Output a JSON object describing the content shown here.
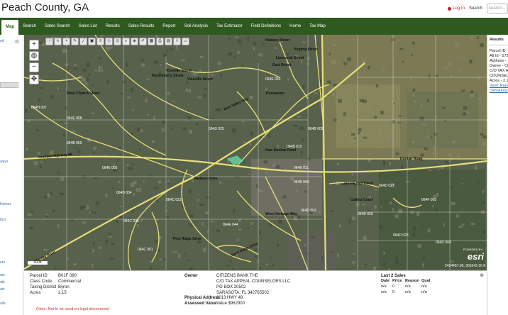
{
  "header": {
    "title": "Peach County, GA",
    "login_label": "Log In",
    "search_label": "Search",
    "search_placeholder": "search..."
  },
  "nav": {
    "items": [
      {
        "label": "Map",
        "active": true
      },
      {
        "label": "Search"
      },
      {
        "label": "Sales Search"
      },
      {
        "label": "Sales List"
      },
      {
        "label": "Results"
      },
      {
        "label": "Sales Results"
      },
      {
        "label": "Report"
      },
      {
        "label": "Soil Analysis"
      },
      {
        "label": "Tax Estimator"
      },
      {
        "label": "Field Definitions"
      },
      {
        "label": "Home"
      },
      {
        "label": "Tax Map"
      }
    ]
  },
  "left_panel": {
    "fragments": [
      "ed",
      "ways",
      "Homes",
      "trict",
      "ers",
      "ats",
      "ats",
      "ats",
      "ults"
    ]
  },
  "right_panel": {
    "title": "Results",
    "lines": [
      "Parcel ID -",
      "Alt Id - 573",
      "Address - 1",
      "Owner - Ci",
      "C/O TAX A",
      "COUNSELI",
      "Acres - 2.1",
      "View: Repo",
      "Definitions"
    ]
  },
  "map": {
    "coords": "2434457.96, 956342.16 ft",
    "esri_text": "esri",
    "powered_by": "POWERED BY",
    "scale_label": "600ft",
    "labels": [
      {
        "text": "Hudson Street"
      },
      {
        "text": "Virginia Street"
      },
      {
        "text": "Lipscomb Street"
      },
      {
        "text": "East Street"
      },
      {
        "text": "Vineville Street"
      },
      {
        "text": "Huckleberry Street"
      },
      {
        "text": "Vineville Street"
      },
      {
        "text": "West Church Street"
      },
      {
        "text": "Rich Valley Way"
      },
      {
        "text": "Thomaston"
      },
      {
        "text": "Georgia Highway 96"
      },
      {
        "text": "New Dunbar Road"
      },
      {
        "text": "Dunbar Road"
      },
      {
        "text": "Jessee Hall Court"
      },
      {
        "text": "Collins Court"
      },
      {
        "text": "Redbud Drive"
      },
      {
        "text": "Pine Ridge Drive"
      },
      {
        "text": "Sand Ridge Drive"
      },
      {
        "text": "West Heritage Way"
      },
      {
        "text": "Conley Road"
      }
    ],
    "parcels": [
      "064H 007",
      "064E 008",
      "064E 059",
      "064E 005",
      "064D 034",
      "064C 033",
      "064C 023",
      "064B 010",
      "064D 003",
      "064B 011",
      "064C 001",
      "064F 003",
      "064B 005",
      "064B 009",
      "064D 027",
      "064B 026",
      "064D 023",
      "064D 004",
      "064E 063",
      "064E 044",
      "064D 025"
    ]
  },
  "info": {
    "fields": [
      {
        "label": "Parcel ID",
        "value": "B01F 080"
      },
      {
        "label": "Class Code",
        "value": "Commercial"
      },
      {
        "label": "Taxing District",
        "value": "Byron"
      },
      {
        "label": "Acres",
        "value": "2.15"
      }
    ],
    "owner_label": "Owner",
    "owner_lines": [
      "CITIZENS BANK THE",
      "C/O TAX APPEAL COUNSELORS LLC",
      "PO BOX 20502",
      "SARASOTA, FL 342765502"
    ],
    "physical_address_label": "Physical Address",
    "physical_address": "1013 HWY 49",
    "assessed_value_label": "Assessed Value",
    "assessed_value": "Value $962900",
    "sales_title": "Last 2 Sales",
    "sales_headers": [
      "Date",
      "Price",
      "Reason",
      "Qual"
    ],
    "sales_rows": [
      [
        "n/a",
        "0",
        "n/a",
        "n/a"
      ],
      [
        "n/a",
        "0",
        "n/a",
        "n/a"
      ]
    ],
    "note": "(Note: Not to be used on legal documents)"
  },
  "colors": {
    "nav_bg": "#2f5a1f",
    "road": "#e8e07a",
    "parcel_line": "#ffffff"
  }
}
